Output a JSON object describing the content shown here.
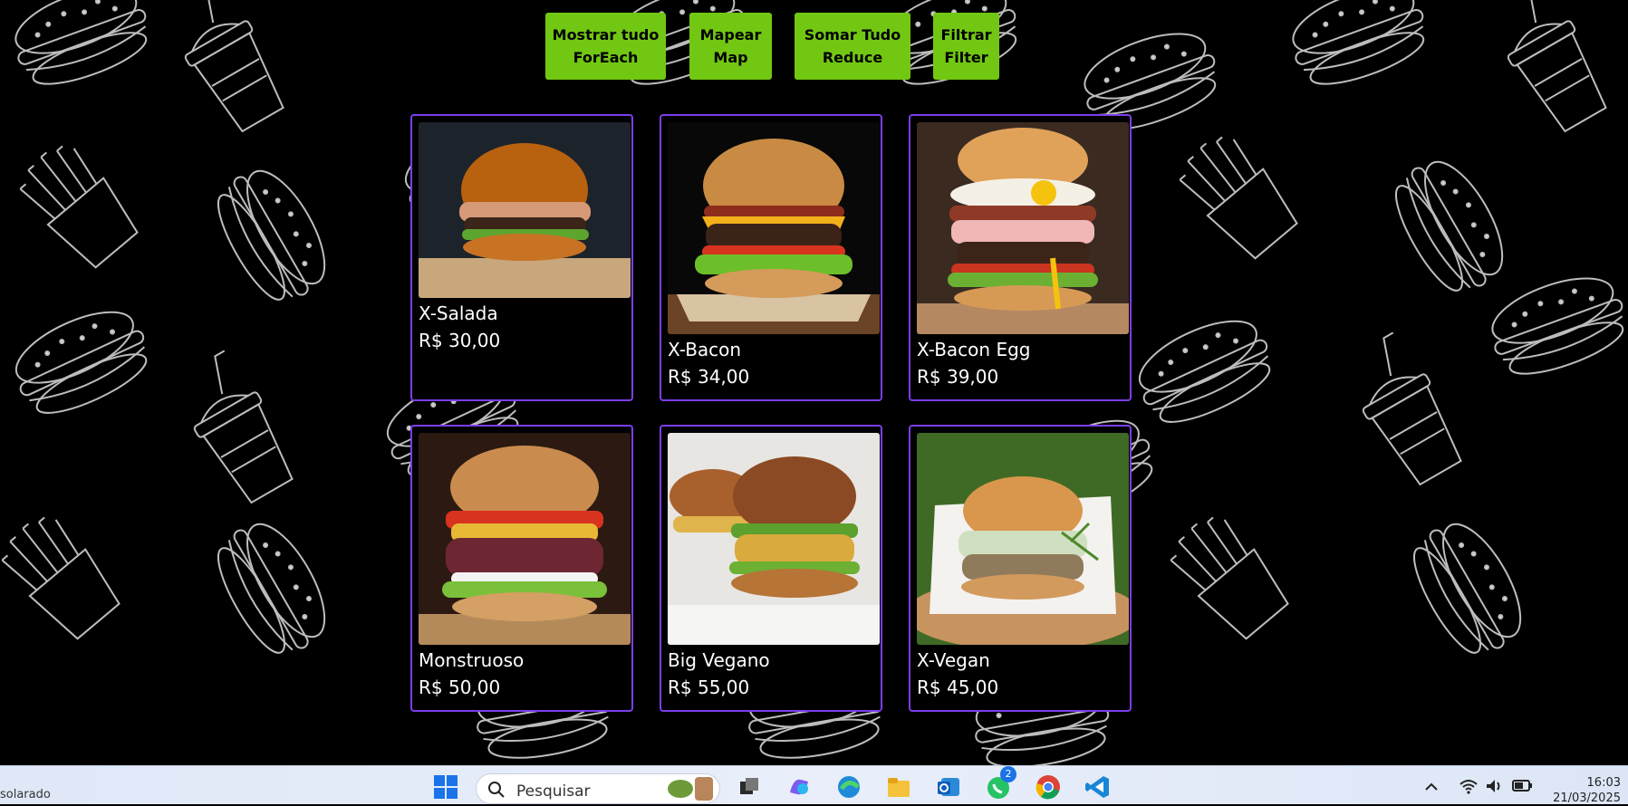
{
  "buttons": [
    {
      "line1": "Mostrar tudo",
      "line2": "ForEach"
    },
    {
      "line1": "Mapear",
      "line2": "Map"
    },
    {
      "line1": "Somar Tudo",
      "line2": "Reduce"
    },
    {
      "line1": "Filtrar",
      "line2": "Filter"
    }
  ],
  "products": [
    {
      "name": "X-Salada",
      "price": "R$ 30,00"
    },
    {
      "name": "X-Bacon",
      "price": "R$ 34,00"
    },
    {
      "name": "X-Bacon Egg",
      "price": "R$ 39,00"
    },
    {
      "name": "Monstruoso",
      "price": "R$ 50,00"
    },
    {
      "name": "Big Vegano",
      "price": "R$ 55,00"
    },
    {
      "name": "X-Vegan",
      "price": "R$ 45,00"
    }
  ],
  "taskbar": {
    "left_text": "solarado",
    "search_placeholder": "Pesquisar",
    "whatsapp_badge": "2",
    "time": "16:03",
    "date": "21/03/2025"
  },
  "colors": {
    "accent_button": "#72c713",
    "card_border": "#7b3ee8",
    "background": "#000000"
  }
}
